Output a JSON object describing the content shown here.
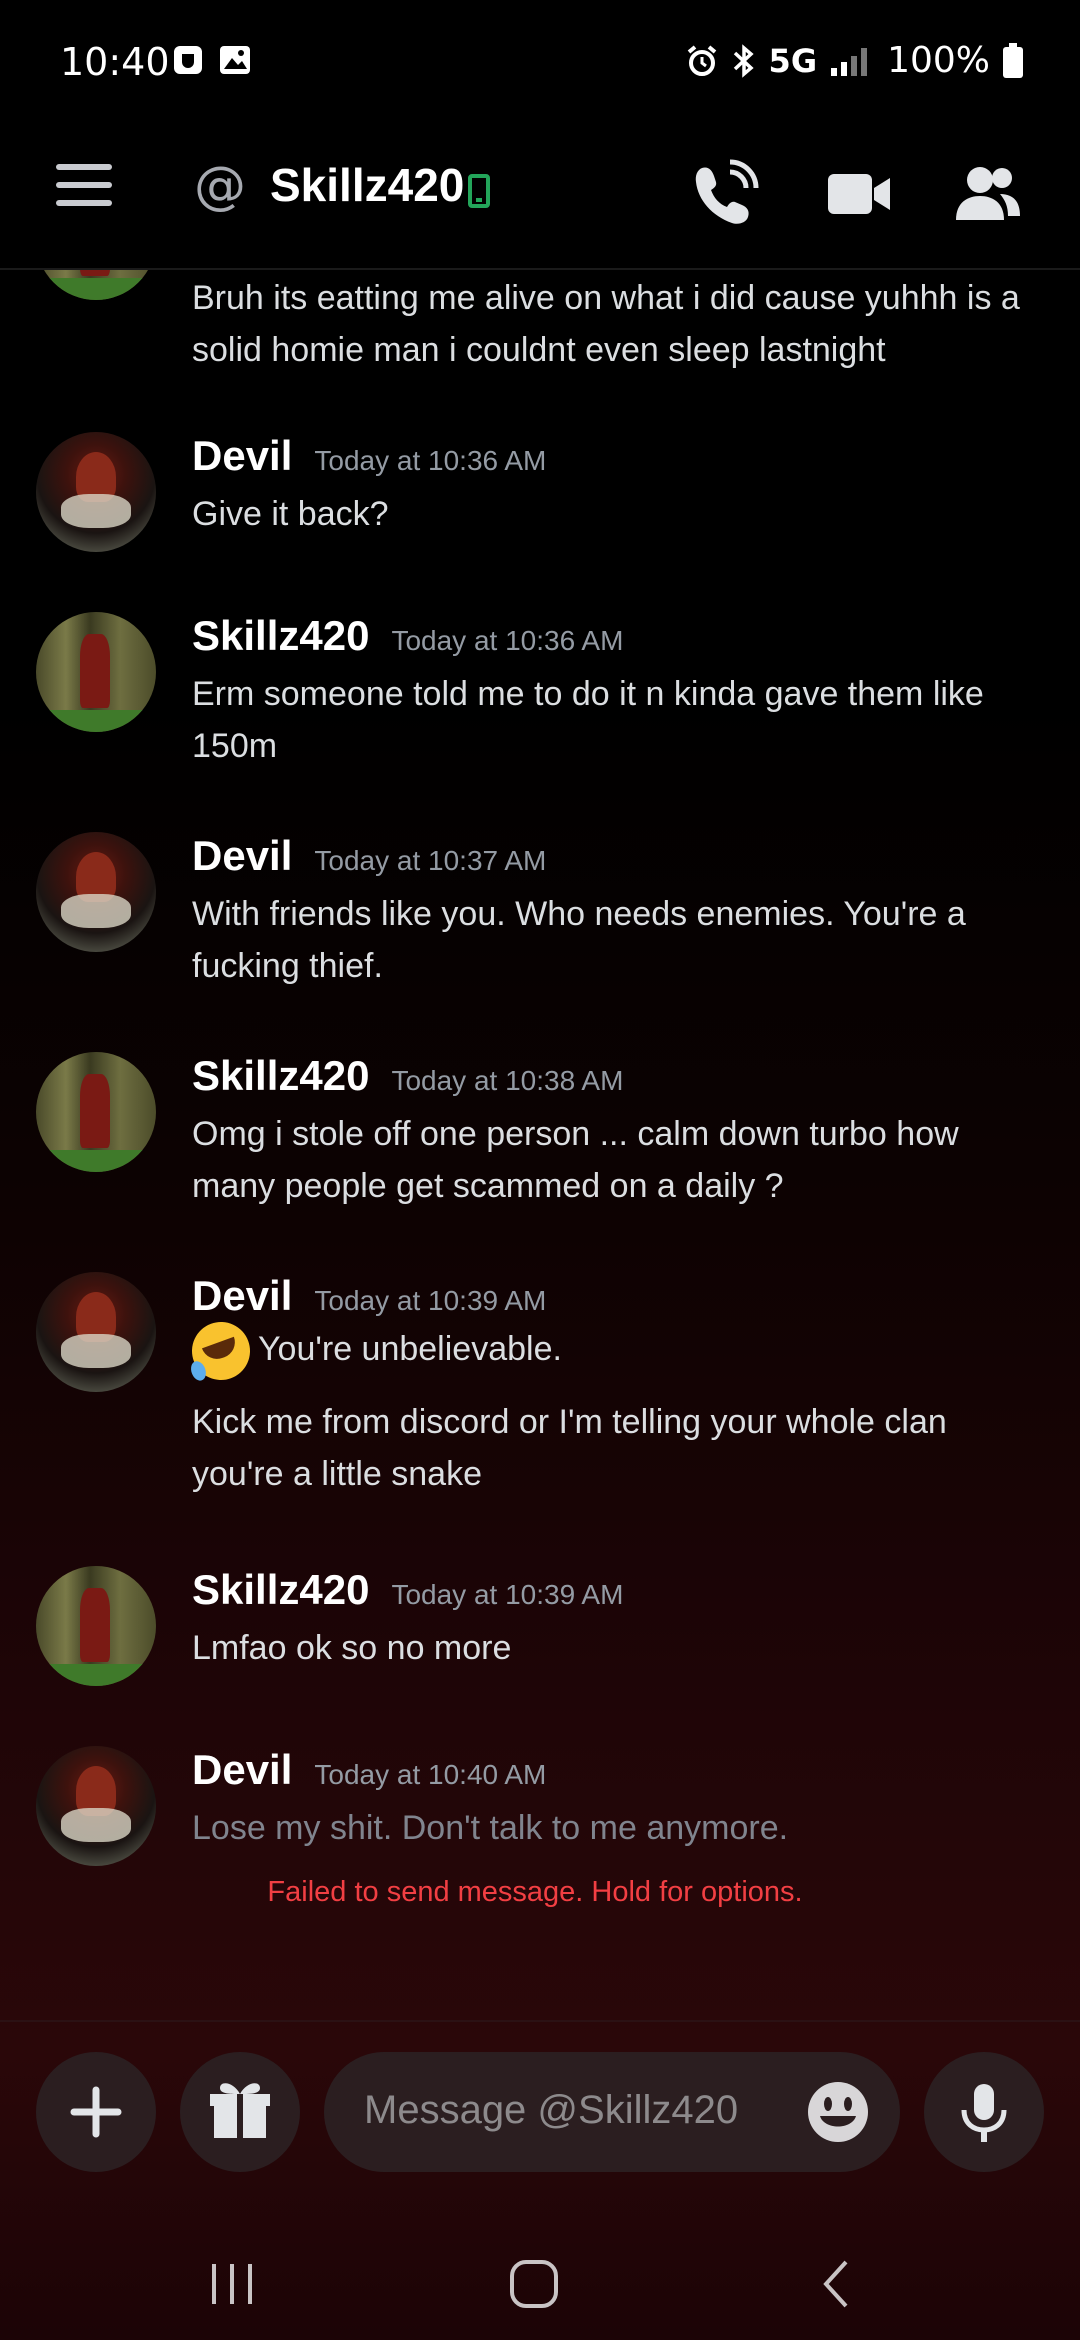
{
  "status_bar": {
    "time": "10:40",
    "network": "5G",
    "battery": "100%"
  },
  "header": {
    "title": "Skillz420"
  },
  "messages": [
    {
      "author": "",
      "timestamp": "",
      "text": "Bruh its eatting me alive on what i did cause yuhhh is a solid homie man i couldnt even sleep lastnight"
    },
    {
      "author": "Devil",
      "timestamp": "Today at 10:36 AM",
      "text": "Give it back?"
    },
    {
      "author": "Skillz420",
      "timestamp": "Today at 10:36 AM",
      "text": "Erm someone told me to do it n kinda gave them like 150m"
    },
    {
      "author": "Devil",
      "timestamp": "Today at 10:37 AM",
      "text": "With friends like you. Who needs enemies. You're a fucking thief."
    },
    {
      "author": "Skillz420",
      "timestamp": "Today at 10:38 AM",
      "text": "Omg i stole off one person ... calm down turbo how many people get scammed on a daily ?"
    },
    {
      "author": "Devil",
      "timestamp": "Today at 10:39 AM",
      "text": "You're unbelievable.",
      "text2": "Kick me from discord or I'm telling your whole clan you're a little snake"
    },
    {
      "author": "Skillz420",
      "timestamp": "Today at 10:39 AM",
      "text": "Lmfao ok so no more"
    },
    {
      "author": "Devil",
      "timestamp": "Today at 10:40 AM",
      "text": "Lose my shit. Don't talk to me anymore.",
      "error": "Failed to send message. Hold for options."
    }
  ],
  "composer": {
    "placeholder": "Message @Skillz420"
  },
  "colors": {
    "online_green": "#23a55a",
    "error_red": "#f23f43",
    "timestamp_gray": "#949ba4"
  },
  "icons": [
    "hamburger-menu-icon",
    "at-icon",
    "mobile-status-icon",
    "voice-call-icon",
    "video-call-icon",
    "members-icon",
    "plus-icon",
    "gift-icon",
    "emoji-icon",
    "microphone-icon",
    "recents-icon",
    "home-icon",
    "back-icon"
  ]
}
